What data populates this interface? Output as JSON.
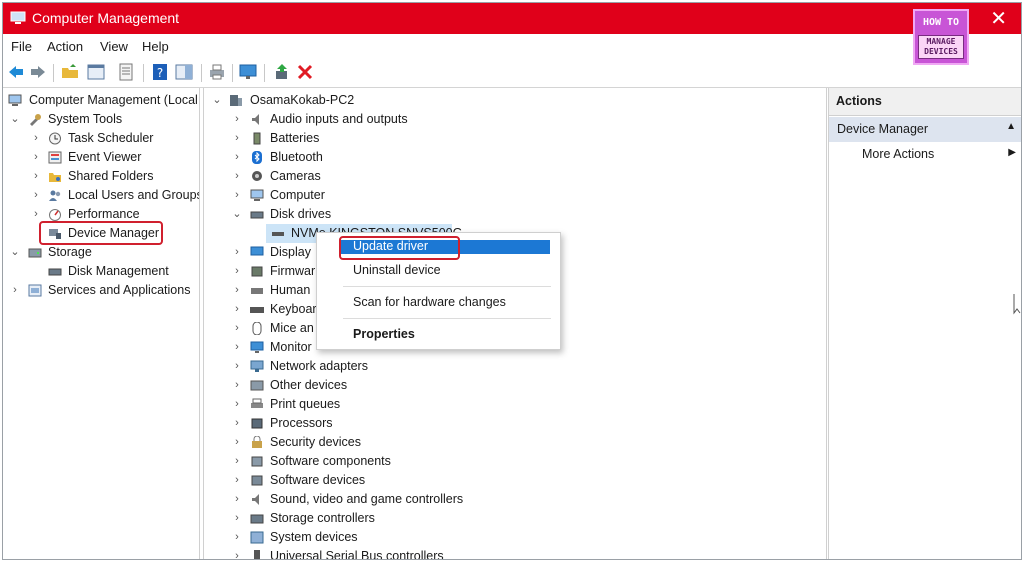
{
  "window": {
    "title": "Computer Management",
    "close_glyph": "✕"
  },
  "logo": {
    "line1": "HOW TO",
    "line2": "MANAGE",
    "line3": "DEVICES"
  },
  "menu": [
    "File",
    "Action",
    "View",
    "Help"
  ],
  "left_tree": {
    "root": "Computer Management (Local",
    "system_tools": "System Tools",
    "task_scheduler": "Task Scheduler",
    "event_viewer": "Event Viewer",
    "shared_folders": "Shared Folders",
    "local_users": "Local Users and Groups",
    "performance": "Performance",
    "device_manager": "Device Manager",
    "storage": "Storage",
    "disk_management": "Disk Management",
    "services": "Services and Applications"
  },
  "device_tree": {
    "root": "OsamaKokab-PC2",
    "disk_child": "NVMe KINGSTON SNVS500G",
    "items": [
      "Audio inputs and outputs",
      "Batteries",
      "Bluetooth",
      "Cameras",
      "Computer",
      "Disk drives",
      "Display",
      "Firmwar",
      "Human",
      "Keyboar",
      "Mice an",
      "Monitor",
      "Network adapters",
      "Other devices",
      "Print queues",
      "Processors",
      "Security devices",
      "Software components",
      "Software devices",
      "Sound, video and game controllers",
      "Storage controllers",
      "System devices",
      "Universal Serial Bus controllers"
    ]
  },
  "context_menu": {
    "update": "Update driver",
    "uninstall": "Uninstall device",
    "scan": "Scan for hardware changes",
    "properties": "Properties"
  },
  "actions": {
    "header": "Actions",
    "section": "Device Manager",
    "more": "More Actions"
  },
  "colors": {
    "title_bar": "#e0001a",
    "highlight": "#d0202e",
    "selection": "#1c78d4",
    "logo_bg": "#c855d6"
  }
}
